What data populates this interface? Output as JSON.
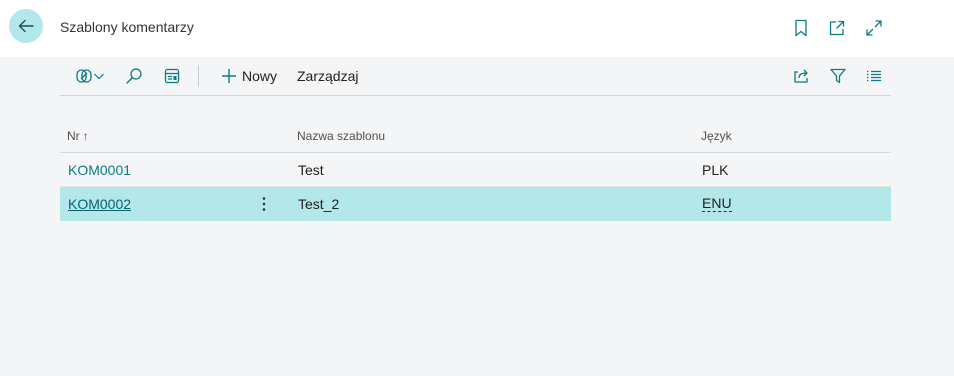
{
  "header": {
    "title": "Szablony komentarzy",
    "icons": [
      "back-arrow-icon",
      "bookmark-icon",
      "open-new-window-icon",
      "expand-icon"
    ]
  },
  "toolbar": {
    "icons": [
      "views-icon",
      "chevron-down-icon",
      "search-icon",
      "edit-list-icon",
      "share-icon",
      "filter-icon",
      "list-view-icon"
    ],
    "new_label": "Nowy",
    "manage_label": "Zarządzaj"
  },
  "table": {
    "columns": [
      {
        "label": "Nr",
        "sort": "↑"
      },
      {
        "label": "Nazwa szablonu"
      },
      {
        "label": "Język"
      }
    ],
    "rows": [
      {
        "nr": "KOM0001",
        "name": "Test",
        "lang": "PLK",
        "selected": false
      },
      {
        "nr": "KOM0002",
        "name": "Test_2",
        "lang": "ENU",
        "selected": true
      }
    ]
  },
  "colors": {
    "accent": "#b3e7ea",
    "link": "#0b7b82",
    "background": "#f4f5f7",
    "icon": "#0b7b82"
  }
}
